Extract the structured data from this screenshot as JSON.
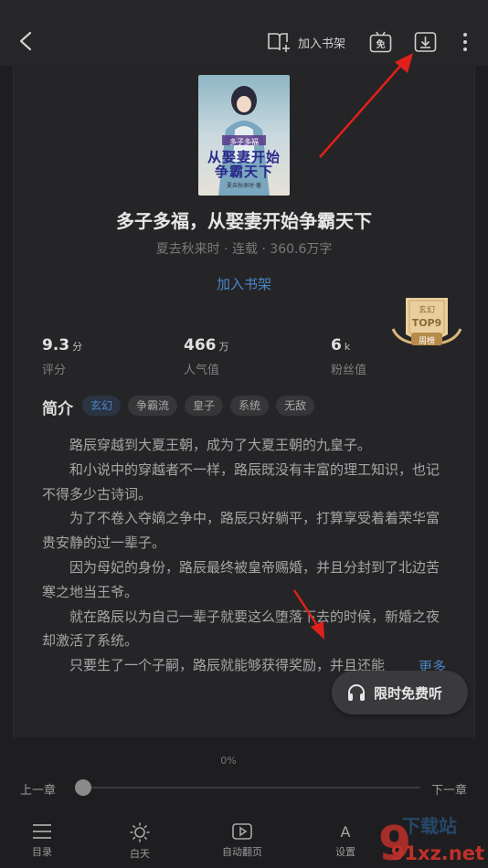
{
  "header": {
    "add_shelf_label": "加入书架",
    "free_label": "免"
  },
  "book": {
    "cover": {
      "small_text": "多子多福",
      "title_line1": "从娶妻开始",
      "title_line2": "争霸天下",
      "publisher": "夏去秋来时·著"
    },
    "title": "多子多福，从娶妻开始争霸天下",
    "meta": "夏去秋来时 · 连载 · 360.6万字",
    "add_shelf_link": "加入书架",
    "badge": {
      "genre": "玄幻",
      "rank": "TOP9",
      "period": "周榜"
    }
  },
  "stats": [
    {
      "value": "9.3",
      "unit": "分",
      "label": "评分"
    },
    {
      "value": "466",
      "unit": "万",
      "label": "人气值"
    },
    {
      "value": "6",
      "unit": "k",
      "label": "粉丝值"
    }
  ],
  "intro": {
    "heading": "简介",
    "tags": [
      "玄幻",
      "争霸流",
      "皇子",
      "系统",
      "无敌"
    ],
    "paragraphs": [
      "路辰穿越到大夏王朝，成为了大夏王朝的九皇子。",
      "和小说中的穿越者不一样，路辰既没有丰富的理工知识，也记不得多少古诗词。",
      "为了不卷入夺嫡之争中，路辰只好躺平，打算享受着着荣华富贵安静的过一辈子。",
      "因为母妃的身份，路辰最终被皇帝赐婚，并且分封到了北边苦寒之地当王爷。",
      "就在路辰以为自己一辈子就要这么堕落下去的时候，新婚之夜却激活了系统。",
      "只要生了一个子嗣，路辰就能够获得奖励，并且还能"
    ],
    "more_label": "更多"
  },
  "listen": {
    "label": "限时免费听"
  },
  "reader": {
    "progress_text": "0%",
    "progress": 0,
    "prev_label": "上一章",
    "next_label": "下一章"
  },
  "toolbar": [
    {
      "label": "目录",
      "icon": "list-icon"
    },
    {
      "label": "白天",
      "icon": "sun-icon"
    },
    {
      "label": "自动翻页",
      "icon": "autoplay-icon"
    },
    {
      "label": "设置",
      "icon": "settings-icon"
    }
  ],
  "watermark": {
    "text": "91xz.net",
    "top_text": "下载站",
    "badge": "9"
  }
}
